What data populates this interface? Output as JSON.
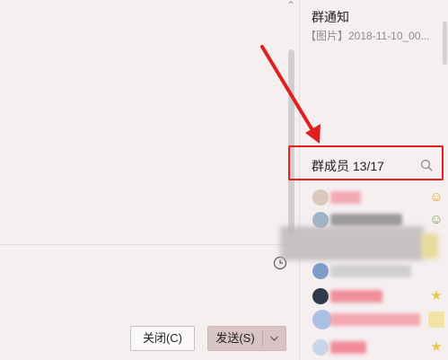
{
  "chat": {
    "close_label": "关闭(C)",
    "send_label": "发送(S)",
    "send_dropdown_icon": "chevron-down-icon",
    "history_icon": "clock-icon"
  },
  "sidebar": {
    "notice_title": "群通知",
    "notice_preview": "【图片】2018-11-10_00...",
    "members_label": "群成员 13/17",
    "search_icon": "search-icon"
  },
  "colors": {
    "highlight": "#e02020",
    "annotation_arrow": "#e02020",
    "background": "#f5eff0"
  }
}
